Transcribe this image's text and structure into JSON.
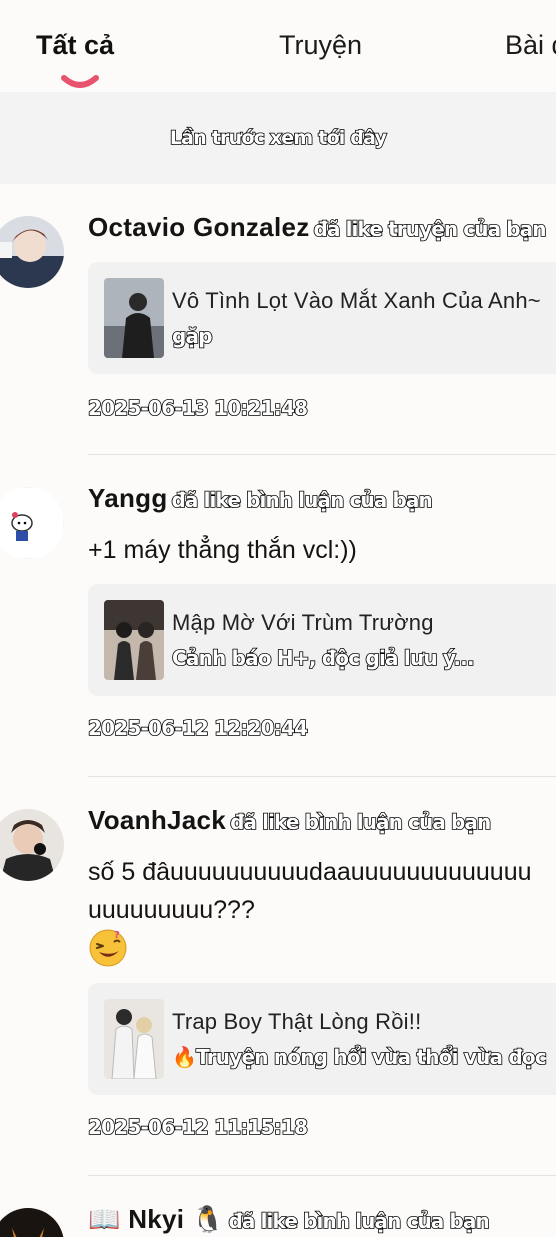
{
  "tabs": [
    {
      "label": "Tất cả",
      "active": true
    },
    {
      "label": "Truyện",
      "active": false
    },
    {
      "label": "Bài đ",
      "active": false
    }
  ],
  "last_seen_label": "Lần trước xem tới đây",
  "notifications": [
    {
      "user": "Octavio Gonzalez",
      "action": "đã like truyện của bạn",
      "story_title": "Vô Tình Lọt Vào Mắt Xanh Của Anh~",
      "story_sub": "gặp",
      "timestamp": "2025-06-13 10:21:48"
    },
    {
      "user": "Yangg",
      "action": "đã like bình luận của bạn",
      "comment": "+1 máy thẳng thắn vcl:))",
      "story_title": "Mập Mờ Với Trùm Trường",
      "story_sub": "Cảnh báo H+, độc giả lưu ý...",
      "timestamp": "2025-06-12 12:20:44"
    },
    {
      "user": "VoanhJack",
      "action": "đã like bình luận của bạn",
      "comment_line1": "số 5 đâuuuuuuuuuudaauuuuuuuuuuuuu",
      "comment_line2": "uuuuuuuuu???",
      "story_title": "Trap Boy Thật Lòng Rồi!!",
      "story_sub": "🔥Truyện nóng hổi vừa thổi vừa đọc",
      "timestamp": "2025-06-12 11:15:18"
    },
    {
      "user": "📖 Nkyi 🐧",
      "action": "đã like bình luận của bạn"
    }
  ],
  "colors": {
    "accent": "#e8546e",
    "background": "#fcfbf9",
    "card": "#f1f1f1"
  }
}
